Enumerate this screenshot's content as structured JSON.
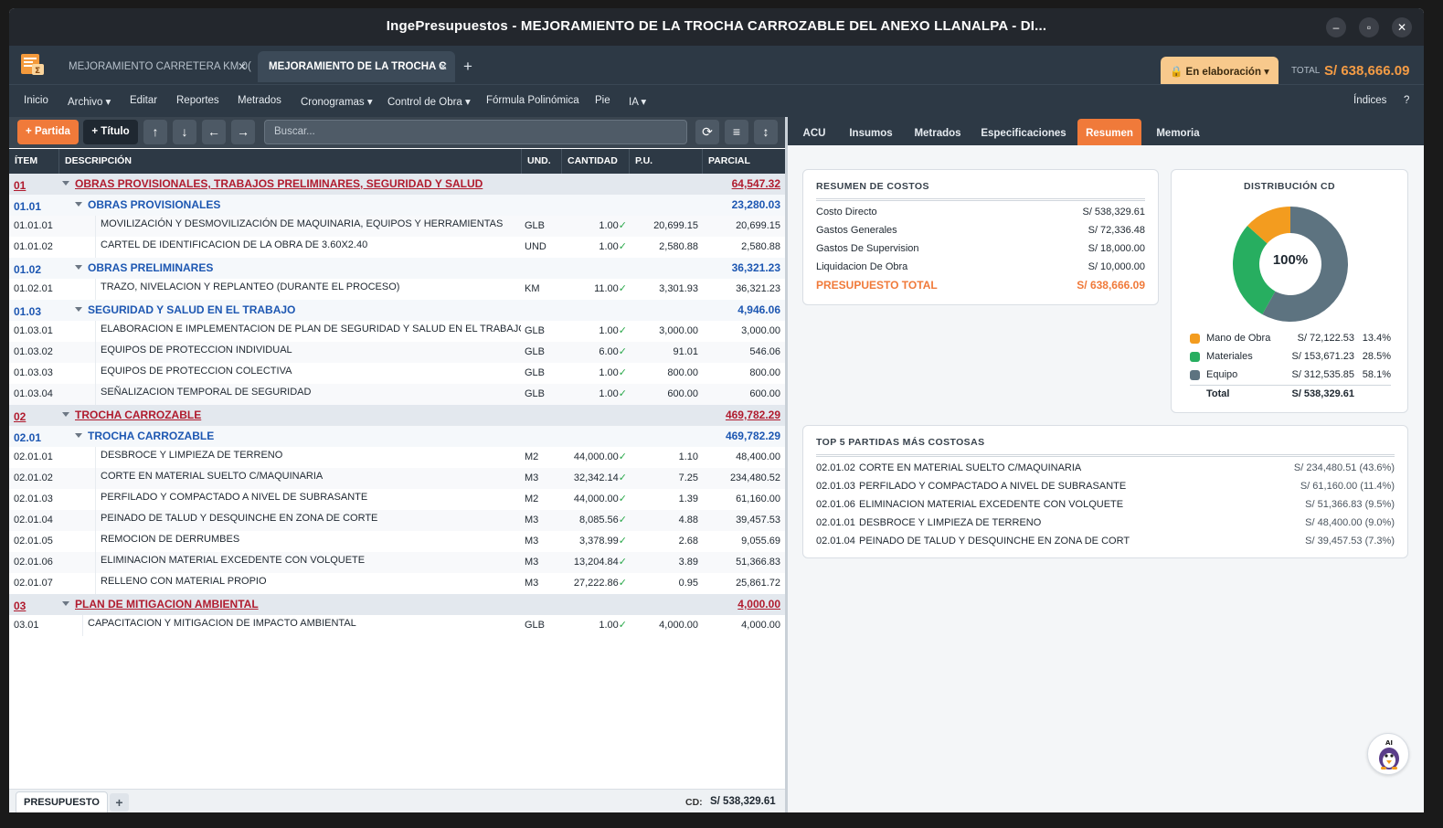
{
  "window": {
    "title": "IngePresupuestos  -  MEJORAMIENTO DE LA TROCHA CARROZABLE DEL ANEXO LLANALPA - DI..."
  },
  "tabs": [
    {
      "label": "MEJORAMIENTO CARRETERA KM 0(",
      "active": false
    },
    {
      "label": "MEJORAMIENTO DE LA TROCHA C",
      "active": true
    }
  ],
  "status": {
    "label": "🔒 En elaboración ▾",
    "total_label": "TOTAL",
    "total_value": "S/ 638,666.09"
  },
  "menu": {
    "items": [
      "Inicio",
      "Archivo ▾",
      "Editar",
      "Reportes",
      "Metrados",
      "Cronogramas ▾",
      "Control de Obra ▾",
      "Fórmula Polinómica",
      "Pie",
      "IA ▾"
    ],
    "right": [
      "Índices",
      "?"
    ]
  },
  "toolbar": {
    "partida": "+ Partida",
    "titulo": "+ Título",
    "search_placeholder": "Buscar..."
  },
  "table": {
    "headers": {
      "item": "ÍTEM",
      "desc": "DESCRIPCIÓN",
      "und": "UND.",
      "cant": "CANTIDAD",
      "pu": "P.U.",
      "parcial": "PARCIAL"
    },
    "rows": [
      {
        "level": 1,
        "item": "01",
        "desc": "OBRAS PROVISIONALES, TRABAJOS PRELIMINARES, SEGURIDAD Y SALUD",
        "und": "",
        "cant": "",
        "pu": "",
        "parcial": "64,547.32"
      },
      {
        "level": 2,
        "item": "01.01",
        "desc": "OBRAS PROVISIONALES",
        "und": "",
        "cant": "",
        "pu": "",
        "parcial": "23,280.03"
      },
      {
        "level": 3,
        "item": "01.01.01",
        "desc": "MOVILIZACIÓN Y DESMOVILIZACIÓN DE MAQUINARIA, EQUIPOS  Y HERRAMIENTAS",
        "und": "GLB",
        "cant": "1.00",
        "pu": "20,699.15",
        "parcial": "20,699.15"
      },
      {
        "level": 3,
        "item": "01.01.02",
        "desc": "CARTEL DE IDENTIFICACION DE LA OBRA DE 3.60X2.40",
        "und": "UND",
        "cant": "1.00",
        "pu": "2,580.88",
        "parcial": "2,580.88"
      },
      {
        "level": 2,
        "item": "01.02",
        "desc": "OBRAS PRELIMINARES",
        "und": "",
        "cant": "",
        "pu": "",
        "parcial": "36,321.23"
      },
      {
        "level": 3,
        "item": "01.02.01",
        "desc": "TRAZO, NIVELACION Y REPLANTEO (DURANTE EL PROCESO)",
        "und": "KM",
        "cant": "11.00",
        "pu": "3,301.93",
        "parcial": "36,321.23"
      },
      {
        "level": 2,
        "item": "01.03",
        "desc": "SEGURIDAD Y SALUD EN EL TRABAJO",
        "und": "",
        "cant": "",
        "pu": "",
        "parcial": "4,946.06"
      },
      {
        "level": 3,
        "item": "01.03.01",
        "desc": "ELABORACION E IMPLEMENTACION DE PLAN DE SEGURIDAD Y SALUD EN EL TRABAJO",
        "und": "GLB",
        "cant": "1.00",
        "pu": "3,000.00",
        "parcial": "3,000.00"
      },
      {
        "level": 3,
        "item": "01.03.02",
        "desc": "EQUIPOS DE PROTECCION INDIVIDUAL",
        "und": "GLB",
        "cant": "6.00",
        "pu": "91.01",
        "parcial": "546.06"
      },
      {
        "level": 3,
        "item": "01.03.03",
        "desc": "EQUIPOS DE PROTECCION COLECTIVA",
        "und": "GLB",
        "cant": "1.00",
        "pu": "800.00",
        "parcial": "800.00"
      },
      {
        "level": 3,
        "item": "01.03.04",
        "desc": "SEÑALIZACION TEMPORAL DE SEGURIDAD",
        "und": "GLB",
        "cant": "1.00",
        "pu": "600.00",
        "parcial": "600.00"
      },
      {
        "level": 1,
        "item": "02",
        "desc": "TROCHA CARROZABLE",
        "und": "",
        "cant": "",
        "pu": "",
        "parcial": "469,782.29"
      },
      {
        "level": 2,
        "item": "02.01",
        "desc": "TROCHA CARROZABLE",
        "und": "",
        "cant": "",
        "pu": "",
        "parcial": "469,782.29"
      },
      {
        "level": 3,
        "item": "02.01.01",
        "desc": "DESBROCE Y LIMPIEZA DE TERRENO",
        "und": "M2",
        "cant": "44,000.00",
        "pu": "1.10",
        "parcial": "48,400.00"
      },
      {
        "level": 3,
        "item": "02.01.02",
        "desc": "CORTE EN MATERIAL SUELTO C/MAQUINARIA",
        "und": "M3",
        "cant": "32,342.14",
        "pu": "7.25",
        "parcial": "234,480.52"
      },
      {
        "level": 3,
        "item": "02.01.03",
        "desc": "PERFILADO Y COMPACTADO A NIVEL DE SUBRASANTE",
        "und": "M2",
        "cant": "44,000.00",
        "pu": "1.39",
        "parcial": "61,160.00"
      },
      {
        "level": 3,
        "item": "02.01.04",
        "desc": "PEINADO DE TALUD Y DESQUINCHE EN ZONA DE CORTE",
        "und": "M3",
        "cant": "8,085.56",
        "pu": "4.88",
        "parcial": "39,457.53"
      },
      {
        "level": 3,
        "item": "02.01.05",
        "desc": "REMOCION DE DERRUMBES",
        "und": "M3",
        "cant": "3,378.99",
        "pu": "2.68",
        "parcial": "9,055.69"
      },
      {
        "level": 3,
        "item": "02.01.06",
        "desc": "ELIMINACION MATERIAL EXCEDENTE CON VOLQUETE",
        "und": "M3",
        "cant": "13,204.84",
        "pu": "3.89",
        "parcial": "51,366.83"
      },
      {
        "level": 3,
        "item": "02.01.07",
        "desc": "RELLENO CON MATERIAL PROPIO",
        "und": "M3",
        "cant": "27,222.86",
        "pu": "0.95",
        "parcial": "25,861.72"
      },
      {
        "level": 1,
        "item": "03",
        "desc": "PLAN DE MITIGACION AMBIENTAL",
        "und": "",
        "cant": "",
        "pu": "",
        "parcial": "4,000.00"
      },
      {
        "level": 4,
        "item": "03.01",
        "desc": "CAPACITACION Y MITIGACION DE IMPACTO AMBIENTAL",
        "und": "GLB",
        "cant": "1.00",
        "pu": "4,000.00",
        "parcial": "4,000.00"
      }
    ]
  },
  "bottom": {
    "sheet_tab": "PRESUPUESTO",
    "add": "+",
    "cd_label": "CD:",
    "cd_value": "S/ 538,329.61"
  },
  "right_tabs": [
    "ACU",
    "Insumos",
    "Metrados",
    "Especificaciones",
    "Resumen",
    "Memoria"
  ],
  "resumen": {
    "title": "RESUMEN DE COSTOS",
    "rows": [
      {
        "label": "Costo Directo",
        "value": "S/ 538,329.61"
      },
      {
        "label": "Gastos Generales",
        "value": "S/ 72,336.48"
      },
      {
        "label": "Gastos De Supervision",
        "value": "S/ 18,000.00"
      },
      {
        "label": "Liquidacion De Obra",
        "value": "S/ 10,000.00"
      }
    ],
    "total_label": "PRESUPUESTO TOTAL",
    "total_value": "S/ 638,666.09"
  },
  "distribucion": {
    "title": "DISTRIBUCIÓN CD",
    "center": "100%",
    "items": [
      {
        "label": "Mano de Obra",
        "value": "S/ 72,122.53",
        "pct": "13.4%",
        "fraction": 0.134,
        "color": "#f39c1f"
      },
      {
        "label": "Materiales",
        "value": "S/ 153,671.23",
        "pct": "28.5%",
        "fraction": 0.285,
        "color": "#27ae60"
      },
      {
        "label": "Equipo",
        "value": "S/ 312,535.85",
        "pct": "58.1%",
        "fraction": 0.581,
        "color": "#5d7380"
      }
    ],
    "total_label": "Total",
    "total_value": "S/ 538,329.61"
  },
  "top5": {
    "title": "TOP 5 PARTIDAS MÁS COSTOSAS",
    "items": [
      {
        "code": "02.01.02",
        "desc": "CORTE EN MATERIAL SUELTO C/MAQUINARIA",
        "amount": "S/ 234,480.51  (43.6%)"
      },
      {
        "code": "02.01.03",
        "desc": "PERFILADO Y COMPACTADO A NIVEL DE SUBRASANTE",
        "amount": "S/ 61,160.00  (11.4%)"
      },
      {
        "code": "02.01.06",
        "desc": "ELIMINACION MATERIAL EXCEDENTE CON VOLQUETE",
        "amount": "S/ 51,366.83  (9.5%)"
      },
      {
        "code": "02.01.01",
        "desc": "DESBROCE Y LIMPIEZA DE TERRENO",
        "amount": "S/ 48,400.00  (9.0%)"
      },
      {
        "code": "02.01.04",
        "desc": "PEINADO DE TALUD Y DESQUINCHE EN ZONA DE CORT",
        "amount": "S/ 39,457.53  (7.3%)"
      }
    ]
  },
  "ai_button": {
    "label": "AI",
    "icon": "penguin-icon"
  }
}
